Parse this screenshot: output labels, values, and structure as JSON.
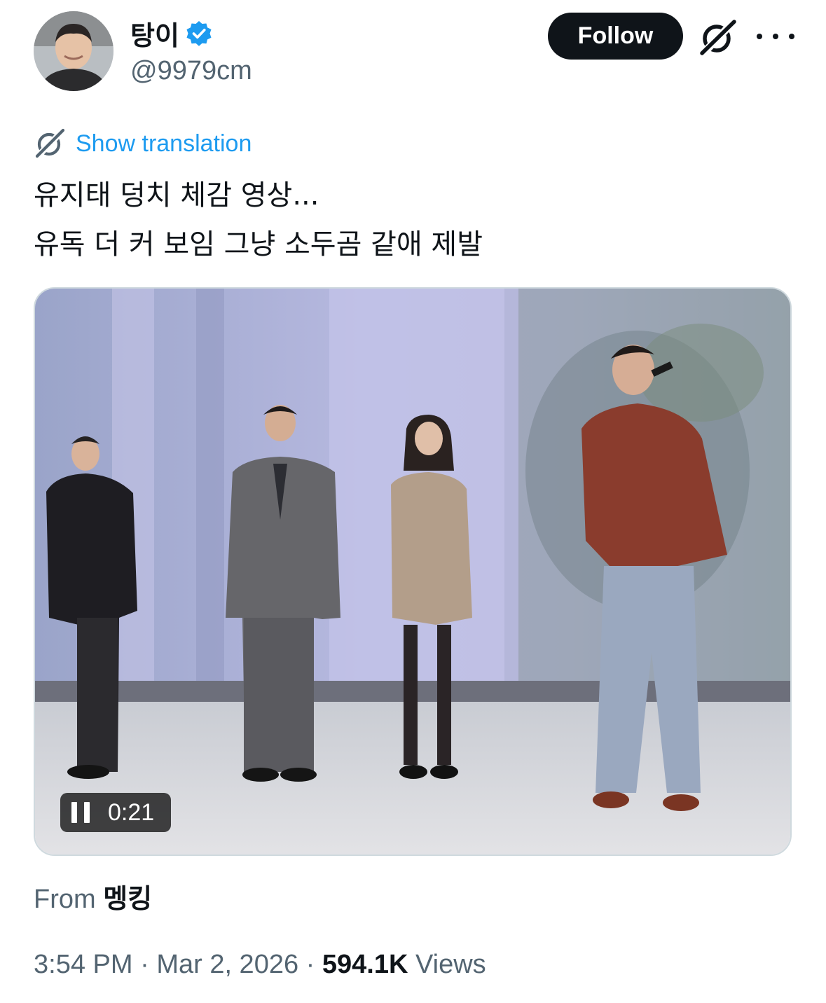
{
  "author": {
    "display_name": "탕이",
    "handle": "@9979cm",
    "verified": true,
    "avatar_icon": "profile-photo"
  },
  "actions": {
    "follow_label": "Follow",
    "grok_icon": "grok-icon",
    "more_icon": "more-dots-icon"
  },
  "translation": {
    "label": "Show translation",
    "icon": "translate-icon"
  },
  "tweet": {
    "lines": [
      "유지태 덩치 체감 영상...",
      "유독 더 커 보임 그냥 소두곰 같애 제발"
    ]
  },
  "video": {
    "timestamp": "0:21",
    "state_icon": "pause-icon"
  },
  "source": {
    "prefix": "From",
    "name": "멩킹"
  },
  "meta": {
    "time": "3:54 PM",
    "separator": "·",
    "date": "Mar 2, 2026",
    "views_count": "594.1K",
    "views_label": "Views"
  },
  "colors": {
    "link": "#1d9bf0",
    "verified": "#1d9bf0",
    "muted": "#536471",
    "button_bg": "#0f1419"
  }
}
